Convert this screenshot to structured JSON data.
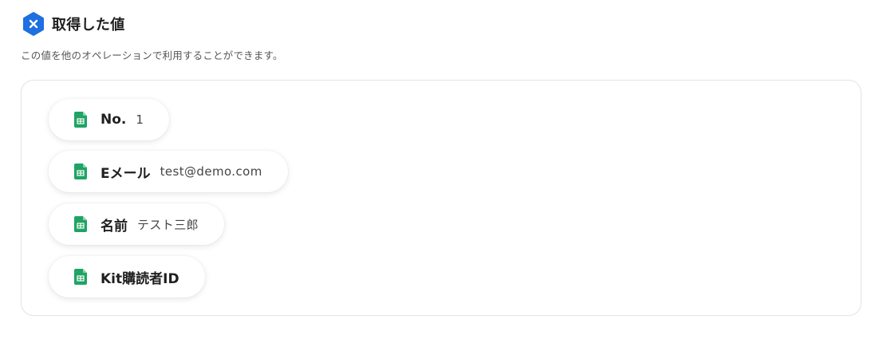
{
  "header": {
    "icon": "yoom-x-hexagon-icon",
    "icon_color": "#1e6fe0",
    "title": "取得した値"
  },
  "description": "この値を他のオペレーションで利用することができます。",
  "sheet_icon": {
    "name": "google-sheets-icon",
    "color": "#1fa463"
  },
  "values": [
    {
      "label": "No.",
      "value": "1"
    },
    {
      "label": "Eメール",
      "value": "test@demo.com"
    },
    {
      "label": "名前",
      "value": "テスト三郎"
    },
    {
      "label": "Kit購読者ID",
      "value": ""
    }
  ]
}
